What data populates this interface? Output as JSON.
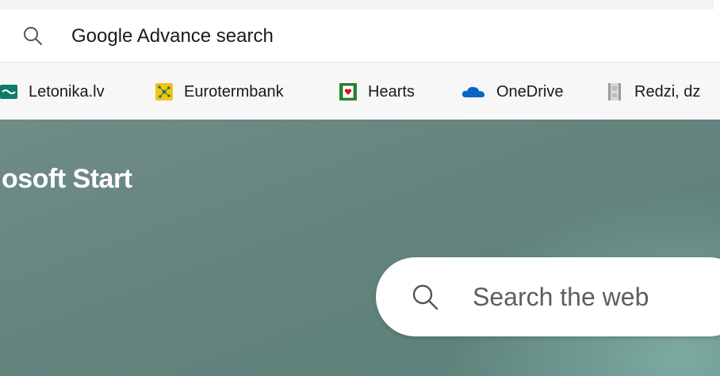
{
  "address_bar": {
    "text": "Google Advance search",
    "icon": "search-icon"
  },
  "bookmarks": [
    {
      "label": "Letonika.lv",
      "icon": "letonika-icon"
    },
    {
      "label": "Eurotermbank",
      "icon": "eurotermbank-icon"
    },
    {
      "label": "Hearts",
      "icon": "hearts-card-icon"
    },
    {
      "label": "OneDrive",
      "icon": "onedrive-cloud-icon"
    },
    {
      "label": "Redzi, dz",
      "icon": "film-strip-icon"
    }
  ],
  "page": {
    "brand": "osoft Start",
    "search": {
      "placeholder": "Search the web",
      "icon": "search-icon"
    }
  },
  "colors": {
    "background_teal": "#67847f",
    "onedrive_blue": "#0a64c8",
    "eurotermbank_yellow": "#f2c418"
  }
}
